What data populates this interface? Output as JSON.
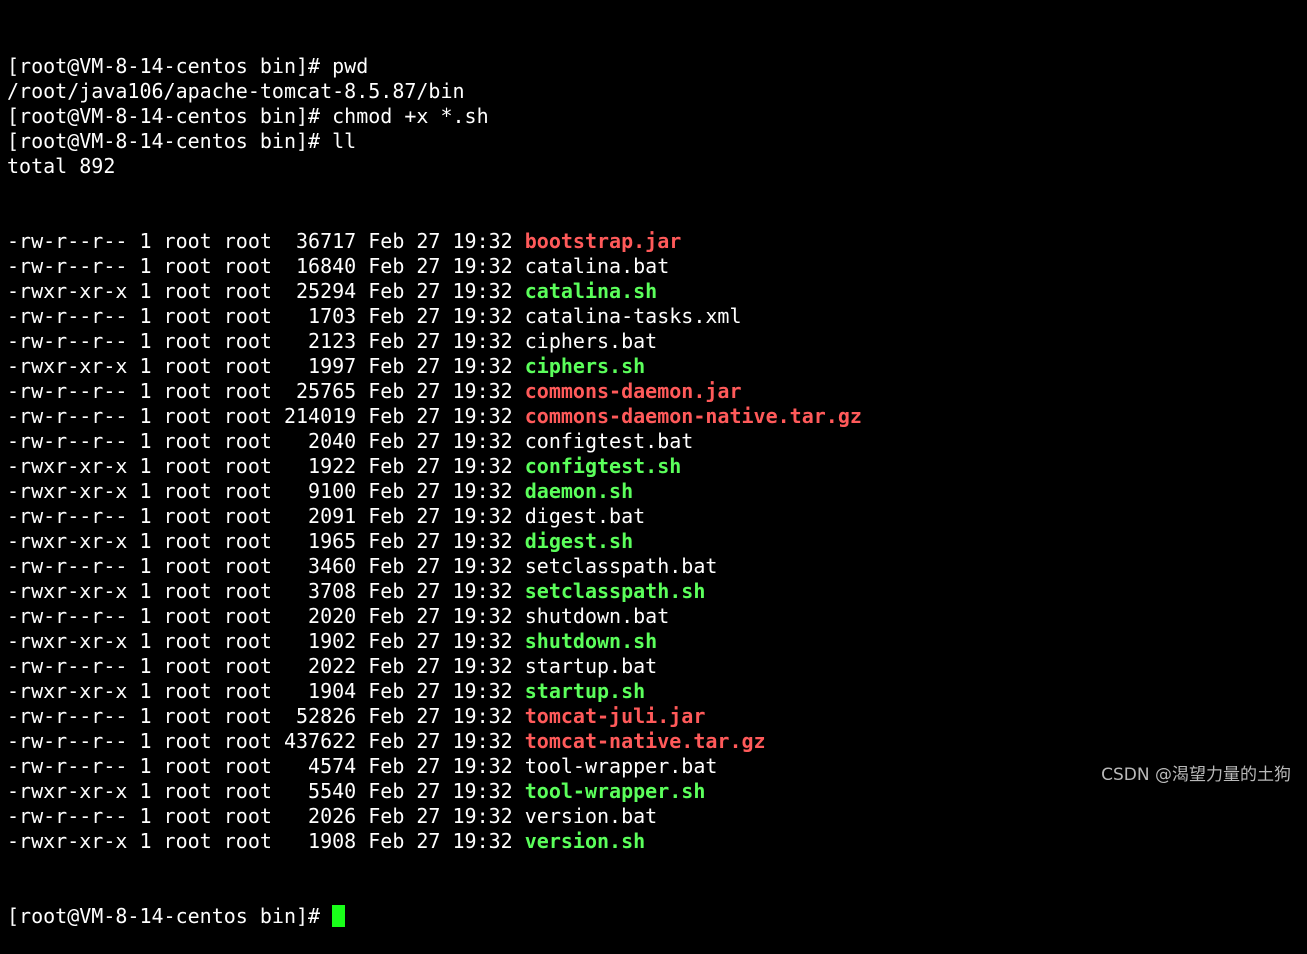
{
  "colors": {
    "background": "#000000",
    "text": "#ffffff",
    "archive_red": "#ff5a5a",
    "exec_green": "#5bff5b",
    "cursor": "#19ff19",
    "watermark": "#b9b9b9"
  },
  "session": {
    "lines": [
      {
        "text": "[root@VM-8-14-centos bin]# pwd"
      },
      {
        "text": "/root/java106/apache-tomcat-8.5.87/bin"
      },
      {
        "text": "[root@VM-8-14-centos bin]# chmod +x *.sh"
      },
      {
        "text": "[root@VM-8-14-centos bin]# ll"
      },
      {
        "text": "total 892"
      }
    ],
    "listing": [
      {
        "meta": "-rw-r--r-- 1 root root  36717 Feb 27 19:32 ",
        "name": "bootstrap.jar",
        "kind": "red"
      },
      {
        "meta": "-rw-r--r-- 1 root root  16840 Feb 27 19:32 ",
        "name": "catalina.bat",
        "kind": "default"
      },
      {
        "meta": "-rwxr-xr-x 1 root root  25294 Feb 27 19:32 ",
        "name": "catalina.sh",
        "kind": "green"
      },
      {
        "meta": "-rw-r--r-- 1 root root   1703 Feb 27 19:32 ",
        "name": "catalina-tasks.xml",
        "kind": "default"
      },
      {
        "meta": "-rw-r--r-- 1 root root   2123 Feb 27 19:32 ",
        "name": "ciphers.bat",
        "kind": "default"
      },
      {
        "meta": "-rwxr-xr-x 1 root root   1997 Feb 27 19:32 ",
        "name": "ciphers.sh",
        "kind": "green"
      },
      {
        "meta": "-rw-r--r-- 1 root root  25765 Feb 27 19:32 ",
        "name": "commons-daemon.jar",
        "kind": "red"
      },
      {
        "meta": "-rw-r--r-- 1 root root 214019 Feb 27 19:32 ",
        "name": "commons-daemon-native.tar.gz",
        "kind": "red"
      },
      {
        "meta": "-rw-r--r-- 1 root root   2040 Feb 27 19:32 ",
        "name": "configtest.bat",
        "kind": "default"
      },
      {
        "meta": "-rwxr-xr-x 1 root root   1922 Feb 27 19:32 ",
        "name": "configtest.sh",
        "kind": "green"
      },
      {
        "meta": "-rwxr-xr-x 1 root root   9100 Feb 27 19:32 ",
        "name": "daemon.sh",
        "kind": "green"
      },
      {
        "meta": "-rw-r--r-- 1 root root   2091 Feb 27 19:32 ",
        "name": "digest.bat",
        "kind": "default"
      },
      {
        "meta": "-rwxr-xr-x 1 root root   1965 Feb 27 19:32 ",
        "name": "digest.sh",
        "kind": "green"
      },
      {
        "meta": "-rw-r--r-- 1 root root   3460 Feb 27 19:32 ",
        "name": "setclasspath.bat",
        "kind": "default"
      },
      {
        "meta": "-rwxr-xr-x 1 root root   3708 Feb 27 19:32 ",
        "name": "setclasspath.sh",
        "kind": "green"
      },
      {
        "meta": "-rw-r--r-- 1 root root   2020 Feb 27 19:32 ",
        "name": "shutdown.bat",
        "kind": "default"
      },
      {
        "meta": "-rwxr-xr-x 1 root root   1902 Feb 27 19:32 ",
        "name": "shutdown.sh",
        "kind": "green"
      },
      {
        "meta": "-rw-r--r-- 1 root root   2022 Feb 27 19:32 ",
        "name": "startup.bat",
        "kind": "default"
      },
      {
        "meta": "-rwxr-xr-x 1 root root   1904 Feb 27 19:32 ",
        "name": "startup.sh",
        "kind": "green"
      },
      {
        "meta": "-rw-r--r-- 1 root root  52826 Feb 27 19:32 ",
        "name": "tomcat-juli.jar",
        "kind": "red"
      },
      {
        "meta": "-rw-r--r-- 1 root root 437622 Feb 27 19:32 ",
        "name": "tomcat-native.tar.gz",
        "kind": "red"
      },
      {
        "meta": "-rw-r--r-- 1 root root   4574 Feb 27 19:32 ",
        "name": "tool-wrapper.bat",
        "kind": "default"
      },
      {
        "meta": "-rwxr-xr-x 1 root root   5540 Feb 27 19:32 ",
        "name": "tool-wrapper.sh",
        "kind": "green"
      },
      {
        "meta": "-rw-r--r-- 1 root root   2026 Feb 27 19:32 ",
        "name": "version.bat",
        "kind": "default"
      },
      {
        "meta": "-rwxr-xr-x 1 root root   1908 Feb 27 19:32 ",
        "name": "version.sh",
        "kind": "green"
      }
    ],
    "final_prompt": "[root@VM-8-14-centos bin]# "
  },
  "watermark": {
    "text": "CSDN @渴望力量的土狗"
  }
}
